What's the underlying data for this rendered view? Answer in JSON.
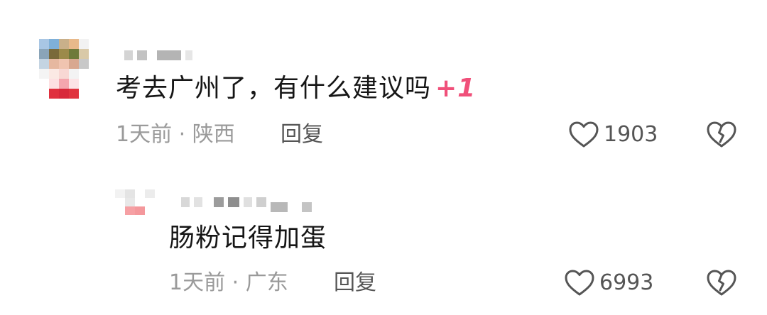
{
  "comments": [
    {
      "text": "考去广州了，有什么建议吗",
      "sticker": "+1",
      "time": "1天前",
      "location": "陕西",
      "reply_label": "回复",
      "likes": "1903"
    },
    {
      "text": "肠粉记得加蛋",
      "time": "1天前",
      "location": "广东",
      "reply_label": "回复",
      "likes": "6993"
    }
  ],
  "separator": "·",
  "icons": {
    "like": "heart-outline-icon",
    "dislike": "broken-heart-icon"
  },
  "colors": {
    "accent": "#f0507a",
    "meta": "#9a9a9a",
    "text": "#161616"
  }
}
